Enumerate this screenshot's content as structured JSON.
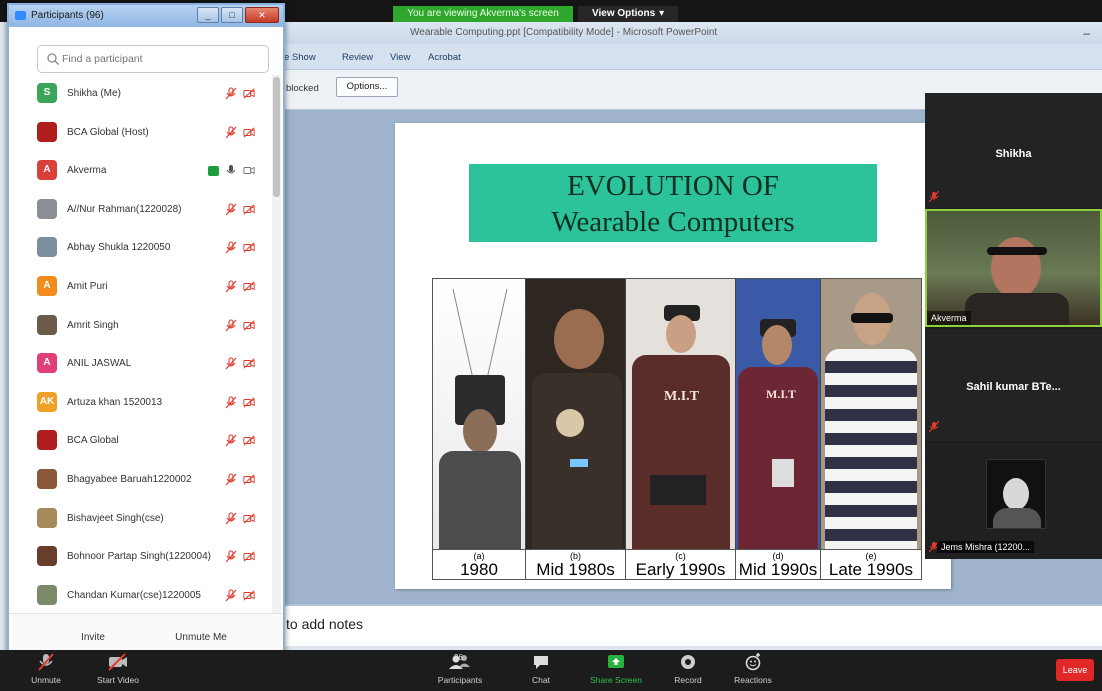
{
  "share_banner": {
    "viewing_text": "You are viewing Akverma's screen",
    "view_options_label": "View Options"
  },
  "ppt": {
    "window_title": "Wearable Computing.ppt [Compatibility Mode] - Microsoft PowerPoint",
    "ribbon_tabs": [
      "e Show",
      "Review",
      "View",
      "Acrobat"
    ],
    "blocked_text": "blocked",
    "options_label": "Options...",
    "notes_text": "to add notes"
  },
  "slide": {
    "title_line1": "EVOLUTION OF",
    "title_line2": "Wearable Computers",
    "captions": [
      {
        "letter": "(a)",
        "era": "1980"
      },
      {
        "letter": "(b)",
        "era": "Mid 1980s"
      },
      {
        "letter": "(c)",
        "era": "Early 1990s"
      },
      {
        "letter": "(d)",
        "era": "Mid 1990s"
      },
      {
        "letter": "(e)",
        "era": "Late 1990s"
      }
    ]
  },
  "participants_panel": {
    "title": "Participants (96)",
    "search_placeholder": "Find a participant",
    "participants": [
      {
        "initial": "S",
        "color": "#3aa65a",
        "name": "Shikha (Me)",
        "muted": true
      },
      {
        "initial": "",
        "color": "#b01d1d",
        "name": "BCA Global (Host)",
        "muted": true
      },
      {
        "initial": "A",
        "color": "#d9403a",
        "name": "Akverma",
        "muted": false,
        "sharing": true
      },
      {
        "initial": "",
        "color": "#8a8f96",
        "name": "A//Nur Rahman(1220028)",
        "muted": true
      },
      {
        "initial": "",
        "color": "#7b8f9e",
        "name": "Abhay Shukla 1220050",
        "muted": true
      },
      {
        "initial": "A",
        "color": "#f08c1e",
        "name": "Amit Puri",
        "muted": true
      },
      {
        "initial": "",
        "color": "#6d5b49",
        "name": "Amrit Singh",
        "muted": true
      },
      {
        "initial": "A",
        "color": "#e0407a",
        "name": "ANIL JASWAL",
        "muted": true
      },
      {
        "initial": "AK",
        "color": "#f0a026",
        "name": "Artuza khan 1520013",
        "muted": true
      },
      {
        "initial": "",
        "color": "#b01d1d",
        "name": "BCA Global",
        "muted": true
      },
      {
        "initial": "",
        "color": "#8b5a3c",
        "name": "Bhagyabee Baruah1220002",
        "muted": true
      },
      {
        "initial": "",
        "color": "#a78a5a",
        "name": "Bishavjeet Singh(cse)",
        "muted": true
      },
      {
        "initial": "",
        "color": "#6a3d2a",
        "name": "Bohnoor Partap Singh(1220004)",
        "muted": true
      },
      {
        "initial": "",
        "color": "#7d8a6a",
        "name": "Chandan Kumar(cse)1220005",
        "muted": true
      },
      {
        "initial": "",
        "color": "#5a6a7a",
        "name": "",
        "muted": true
      }
    ],
    "invite_label": "Invite",
    "unmute_me_label": "Unmute Me"
  },
  "video_tiles": {
    "shikha_name": "Shikha",
    "akverma_name": "Akverma",
    "sahil_name": "Sahil kumar BTe...",
    "jems_name": "Jems Mishra (12200..."
  },
  "toolbar": {
    "unmute_label": "Unmute",
    "start_video_label": "Start Video",
    "participants_label": "Participants",
    "participants_count": "96",
    "chat_label": "Chat",
    "share_screen_label": "Share Screen",
    "record_label": "Record",
    "reactions_label": "Reactions",
    "leave_label": "Leave"
  },
  "colors": {
    "accent_green": "#2fa72f",
    "slide_title_bg": "#2cc29a",
    "leave_red": "#e02828",
    "mute_red": "#e03a2e"
  },
  "icons": [
    "search-icon",
    "mic-muted-icon",
    "camera-off-icon",
    "mic-icon",
    "camera-icon",
    "share-icon",
    "participants-icon",
    "chat-icon",
    "record-icon",
    "reactions-icon"
  ]
}
